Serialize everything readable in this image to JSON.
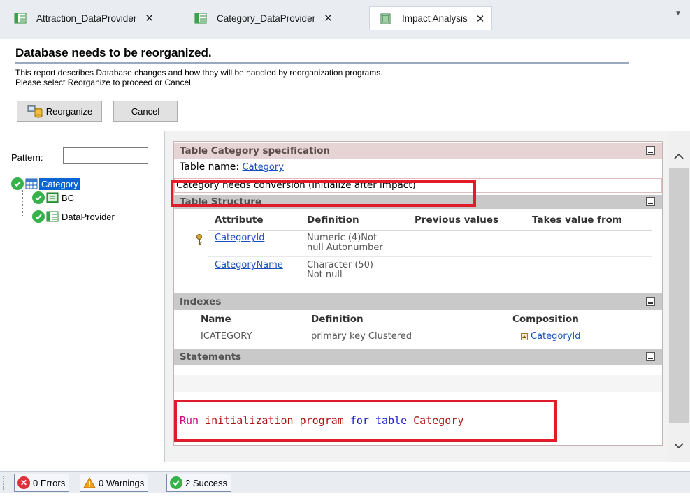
{
  "tabs": [
    {
      "label": "Attraction_DataProvider",
      "icon": "dataprovider-icon",
      "active": false
    },
    {
      "label": "Category_DataProvider",
      "icon": "dataprovider-icon",
      "active": false
    },
    {
      "label": "Impact Analysis",
      "icon": "impact-analysis-icon",
      "active": true
    }
  ],
  "header": {
    "title": "Database needs to be reorganized.",
    "desc_line1": "This report describes Database changes and how they will be handled by reorganization programs.",
    "desc_line2": "Please select Reorganize to proceed or Cancel.",
    "reorganize_label": "Reorganize",
    "cancel_label": "Cancel"
  },
  "filter": {
    "label": "Pattern:",
    "value": ""
  },
  "tree": {
    "root": "Category",
    "children": [
      "BC",
      "DataProvider"
    ]
  },
  "report": {
    "spec_title": "Table Category specification",
    "table_name_label": "Table name:",
    "table_name": "Category",
    "conversion_note": "Category needs conversion (initialize after impact)",
    "structure_title": "Table Structure",
    "structure_columns": [
      "Attribute",
      "Definition",
      "Previous values",
      "Takes value from"
    ],
    "structure_rows": [
      {
        "attribute": "CategoryId",
        "definition_l1": "Numeric (4)Not",
        "definition_l2": "null Autonumber",
        "key": true
      },
      {
        "attribute": "CategoryName",
        "definition_l1": "Character (50)",
        "definition_l2": "Not null",
        "key": false
      }
    ],
    "indexes_title": "Indexes",
    "index_columns": [
      "Name",
      "Definition",
      "Composition"
    ],
    "index_rows": [
      {
        "name": "ICATEGORY",
        "definition": "primary key Clustered",
        "composition": "CategoryId"
      }
    ],
    "statements_title": "Statements",
    "statement": {
      "run": "Run",
      "middle": " initialization program ",
      "for_table": "for table",
      "table": " Category"
    }
  },
  "status": {
    "errors": "0 Errors",
    "warnings": "0 Warnings",
    "success": "2 Success"
  },
  "colors": {
    "highlight_box": "#e21b2b",
    "success_green": "#35b34a",
    "error_red": "#e0303a",
    "warning_orange": "#f5a020",
    "section_pink": "#e6d3d3"
  }
}
